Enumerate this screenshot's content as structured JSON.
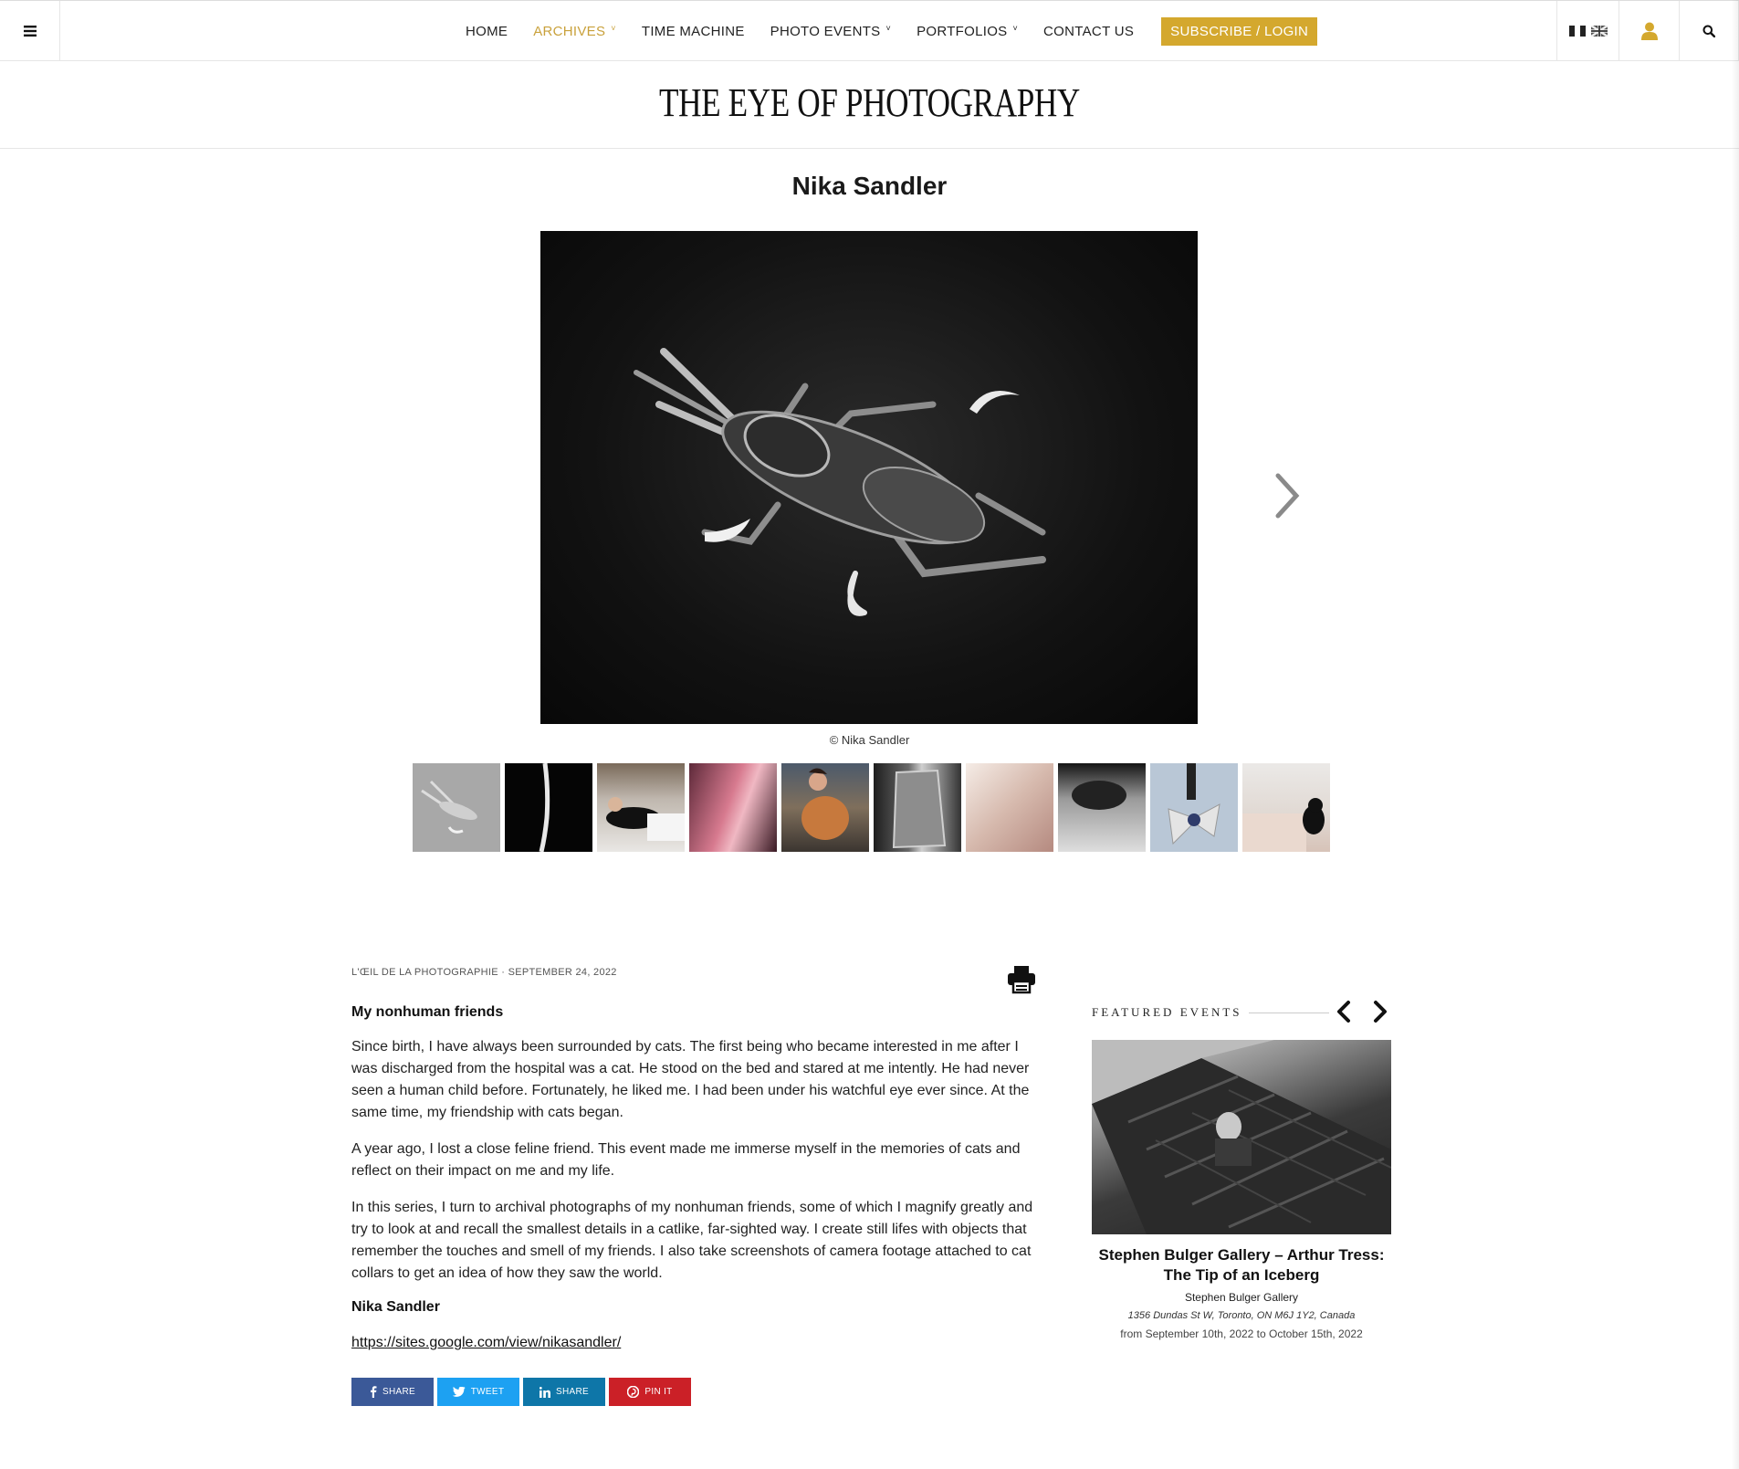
{
  "header": {
    "nav": [
      {
        "label": "HOME",
        "has_caret": false
      },
      {
        "label": "ARCHIVES",
        "has_caret": true,
        "active": true
      },
      {
        "label": "TIME MACHINE",
        "has_caret": false
      },
      {
        "label": "PHOTO EVENTS",
        "has_caret": true
      },
      {
        "label": "PORTFOLIOS",
        "has_caret": true
      },
      {
        "label": "CONTACT US",
        "has_caret": false
      }
    ],
    "subscribe_label": "SUBSCRIBE / LOGIN",
    "icons": [
      "menu-icon",
      "french-flag-icon",
      "uk-flag-icon",
      "user-icon",
      "search-icon"
    ],
    "accent_color": "#d4a82e"
  },
  "site": {
    "logo": "THE EYE OF PHOTOGRAPHY"
  },
  "gallery": {
    "title": "Nika Sandler",
    "credit": "© Nika Sandler",
    "thumbnail_count": 10
  },
  "article": {
    "source": "L'ŒIL DE LA PHOTOGRAPHIE",
    "separator": " · ",
    "date": "SEPTEMBER 24, 2022",
    "subtitle": "My nonhuman friends",
    "paragraphs": [
      "Since birth, I have always been surrounded by cats. The first being who became interested in me after I was discharged from the hospital was a cat. He stood on the bed and stared at me intently. He had never seen a human child before. Fortunately, he liked me. I had been under his watchful eye ever since. At the same time, my friendship with cats began.",
      "A year ago, I lost a close feline friend. This event made me immerse myself in the memories of cats and reflect on their impact on me and my life.",
      "In this series, I turn to archival photographs of my nonhuman friends, some of which I magnify greatly and try to look at and recall the smallest details in a catlike, far-sighted way. I create still lifes with objects that remember the touches and smell of my friends. I also take screenshots of camera footage attached to cat collars to get an idea of how they saw the world."
    ],
    "author": "Nika Sandler",
    "link": "https://sites.google.com/view/nikasandler/",
    "share_buttons": [
      {
        "label": "SHARE",
        "network": "facebook",
        "color": "#3b5998"
      },
      {
        "label": "TWEET",
        "network": "twitter",
        "color": "#1da1f2"
      },
      {
        "label": "SHARE",
        "network": "linkedin",
        "color": "#0e76a8"
      },
      {
        "label": "PIN IT",
        "network": "pinterest",
        "color": "#cb2027"
      }
    ]
  },
  "featured_events": {
    "heading": "FEATURED EVENTS",
    "event": {
      "title": "Stephen Bulger Gallery – Arthur Tress: The Tip of an Iceberg",
      "gallery": "Stephen Bulger Gallery",
      "address": "1356 Dundas St W, Toronto, ON M6J 1Y2, Canada",
      "dates": "from September 10th, 2022 to October 15th, 2022"
    }
  }
}
